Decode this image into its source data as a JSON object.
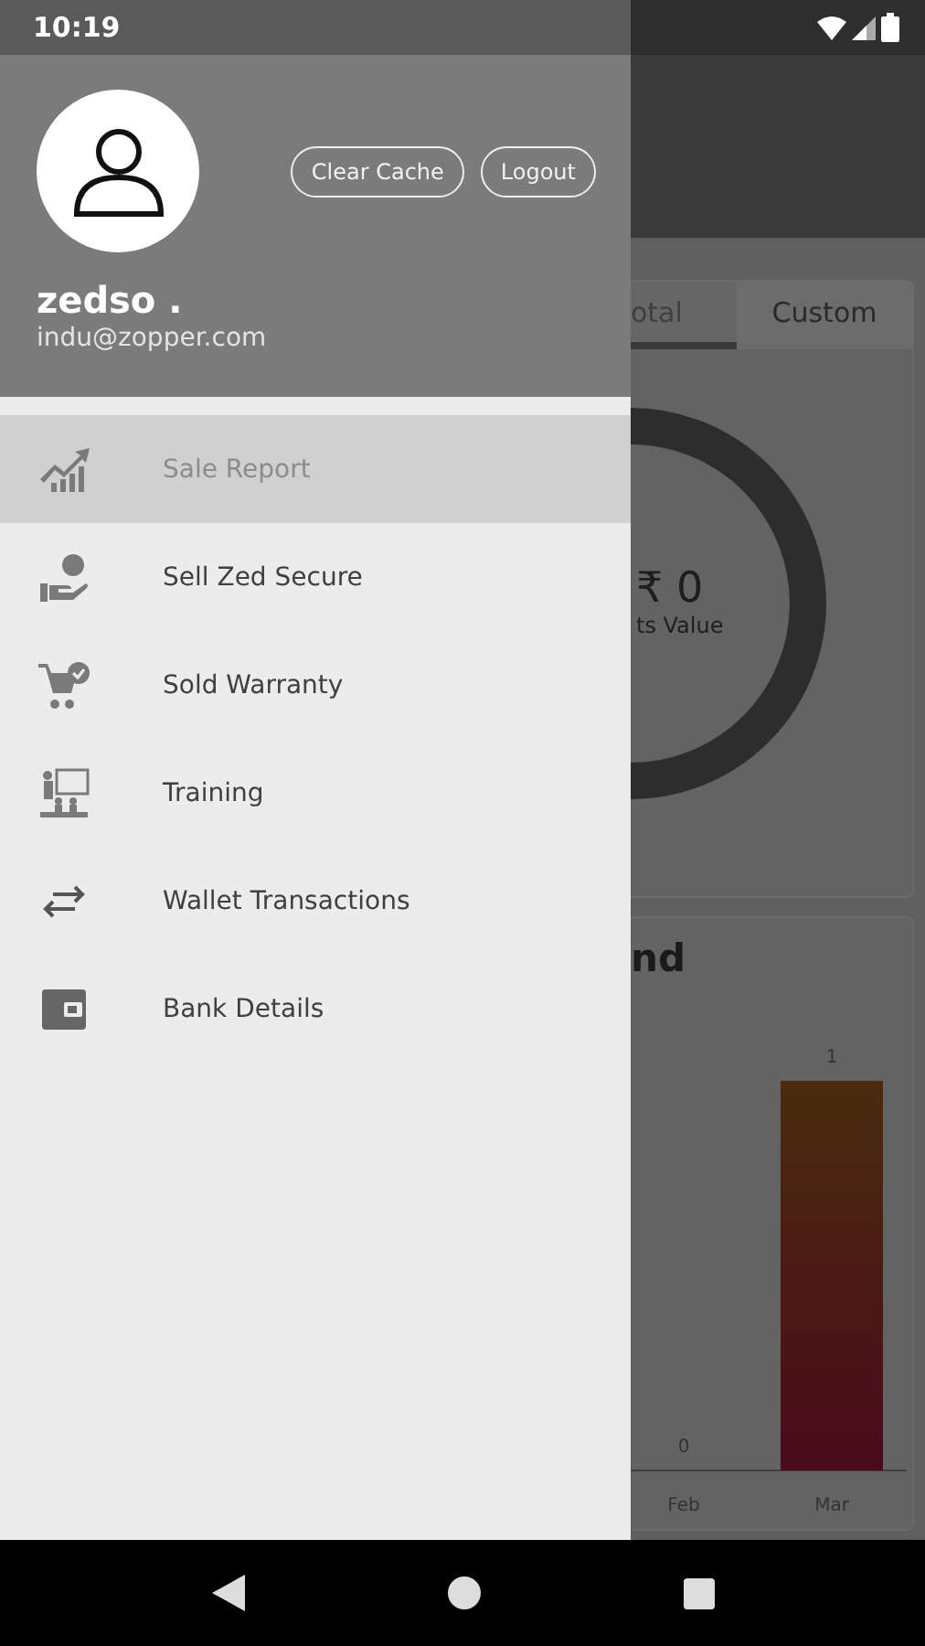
{
  "status_bar": {
    "time": "10:19"
  },
  "drawer": {
    "user": {
      "name": "zedso .",
      "email": "indu@zopper.com"
    },
    "buttons": [
      "Clear Cache",
      "Logout"
    ],
    "items": [
      {
        "label": "Sale Report",
        "kind": "chart",
        "selected": true
      },
      {
        "label": "Sell Zed Secure",
        "kind": "hand",
        "selected": false
      },
      {
        "label": "Sold Warranty",
        "kind": "cart",
        "selected": false
      },
      {
        "label": "Training",
        "kind": "training",
        "selected": false
      },
      {
        "label": "Wallet Transactions",
        "kind": "arrows",
        "selected": false
      },
      {
        "label": "Bank Details",
        "kind": "wallet",
        "selected": false
      }
    ]
  },
  "background": {
    "tabs": [
      {
        "label": "otal",
        "selected": true
      },
      {
        "label": "Custom",
        "selected": false
      }
    ],
    "summary": {
      "value": "₹ 0",
      "caption": "ts Value"
    },
    "trend_card": {
      "title": "nd",
      "chart_data": {
        "type": "bar",
        "categories": [
          "Feb",
          "Mar"
        ],
        "values": [
          0,
          1
        ],
        "data_labels": true
      }
    }
  }
}
